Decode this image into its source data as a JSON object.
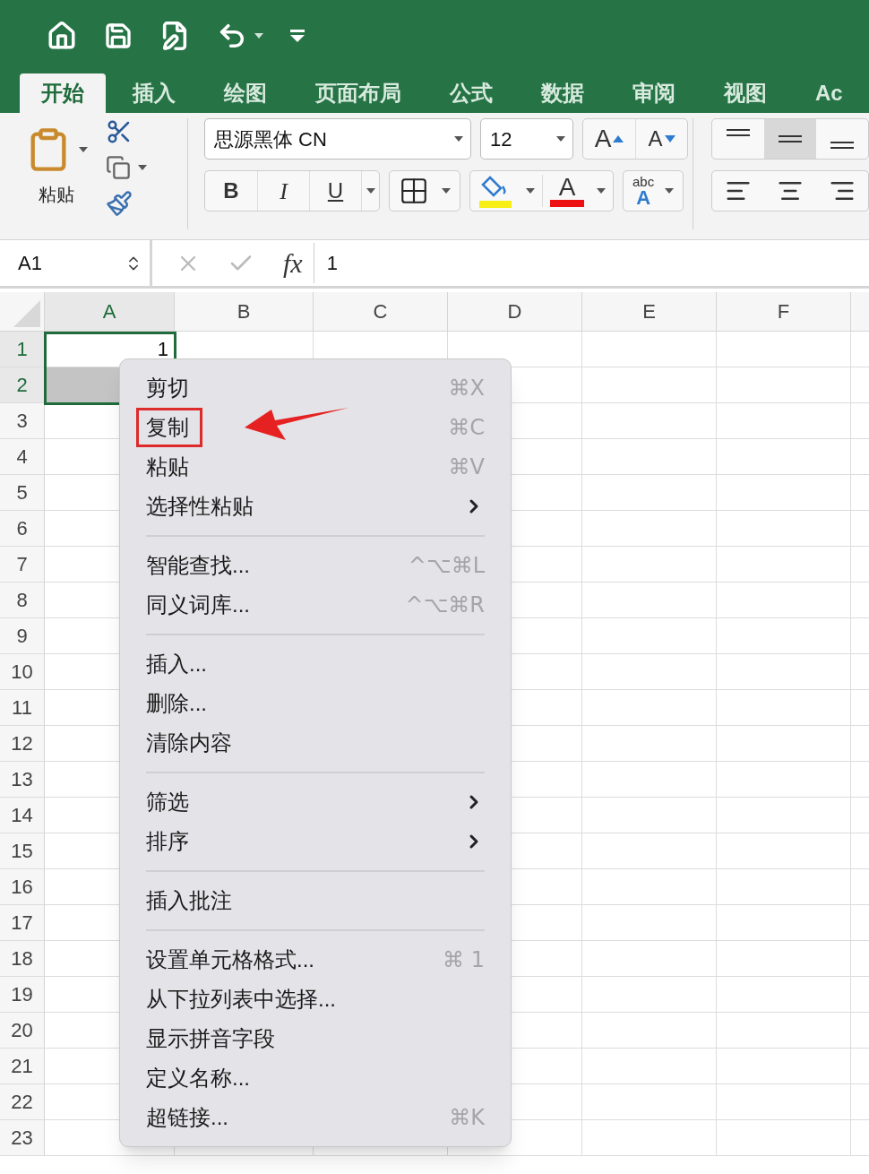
{
  "ribbon_tabs": [
    {
      "label": "开始",
      "selected": true
    },
    {
      "label": "插入",
      "selected": false
    },
    {
      "label": "绘图",
      "selected": false
    },
    {
      "label": "页面布局",
      "selected": false
    },
    {
      "label": "公式",
      "selected": false
    },
    {
      "label": "数据",
      "selected": false
    },
    {
      "label": "审阅",
      "selected": false
    },
    {
      "label": "视图",
      "selected": false
    },
    {
      "label": "Ac",
      "selected": false
    }
  ],
  "clipboard": {
    "paste_label": "粘贴"
  },
  "font": {
    "name": "思源黑体 CN",
    "size": "12",
    "grow_label": "A",
    "shrink_label": "A",
    "bold_label": "B",
    "italic_label": "I",
    "underline_label": "U",
    "font_color_label": "A",
    "phonetic_top": "abc",
    "phonetic_bottom": "A"
  },
  "vertical_align": [
    {
      "kind": "top",
      "selected": false
    },
    {
      "kind": "middle",
      "selected": true
    },
    {
      "kind": "bottom",
      "selected": false
    }
  ],
  "formula_bar": {
    "name_box": "A1",
    "fx": "fx",
    "value": "1"
  },
  "columns": [
    {
      "label": "A",
      "selected": true
    },
    {
      "label": "B",
      "selected": false
    },
    {
      "label": "C",
      "selected": false
    },
    {
      "label": "D",
      "selected": false
    },
    {
      "label": "E",
      "selected": false
    },
    {
      "label": "F",
      "selected": false
    }
  ],
  "rows": [
    {
      "label": "1",
      "selected": true,
      "cell_a": "1"
    },
    {
      "label": "2",
      "selected": true
    },
    {
      "label": "3",
      "selected": false
    },
    {
      "label": "4",
      "selected": false
    },
    {
      "label": "5",
      "selected": false
    },
    {
      "label": "6",
      "selected": false
    },
    {
      "label": "7",
      "selected": false
    },
    {
      "label": "8",
      "selected": false
    },
    {
      "label": "9",
      "selected": false
    },
    {
      "label": "10",
      "selected": false
    },
    {
      "label": "11",
      "selected": false
    },
    {
      "label": "12",
      "selected": false
    },
    {
      "label": "13",
      "selected": false
    },
    {
      "label": "14",
      "selected": false
    },
    {
      "label": "15",
      "selected": false
    },
    {
      "label": "16",
      "selected": false
    },
    {
      "label": "17",
      "selected": false
    },
    {
      "label": "18",
      "selected": false
    },
    {
      "label": "19",
      "selected": false
    },
    {
      "label": "20",
      "selected": false
    },
    {
      "label": "21",
      "selected": false
    },
    {
      "label": "22",
      "selected": false
    },
    {
      "label": "23",
      "selected": false
    }
  ],
  "context_menu": [
    [
      {
        "label": "剪切",
        "shortcut": "⌘X",
        "submenu": false,
        "annotated": false
      },
      {
        "label": "复制",
        "shortcut": "⌘C",
        "submenu": false,
        "annotated": true
      },
      {
        "label": "粘贴",
        "shortcut": "⌘V",
        "submenu": false,
        "annotated": false
      },
      {
        "label": "选择性粘贴",
        "submenu": true,
        "annotated": false
      }
    ],
    [
      {
        "label": "智能查找...",
        "shortcut": "^⌥⌘L",
        "submenu": false,
        "annotated": false
      },
      {
        "label": "同义词库...",
        "shortcut": "^⌥⌘R",
        "submenu": false,
        "annotated": false
      }
    ],
    [
      {
        "label": "插入...",
        "submenu": false,
        "annotated": false
      },
      {
        "label": "删除...",
        "submenu": false,
        "annotated": false
      },
      {
        "label": "清除内容",
        "submenu": false,
        "annotated": false
      }
    ],
    [
      {
        "label": "筛选",
        "submenu": true,
        "annotated": false
      },
      {
        "label": "排序",
        "submenu": true,
        "annotated": false
      }
    ],
    [
      {
        "label": "插入批注",
        "submenu": false,
        "annotated": false
      }
    ],
    [
      {
        "label": "设置单元格格式...",
        "shortcut": "⌘ 1",
        "submenu": false,
        "annotated": false
      },
      {
        "label": "从下拉列表中选择...",
        "submenu": false,
        "annotated": false
      },
      {
        "label": "显示拼音字段",
        "submenu": false,
        "annotated": false
      },
      {
        "label": "定义名称...",
        "submenu": false,
        "annotated": false
      },
      {
        "label": "超链接...",
        "shortcut": "⌘K",
        "submenu": false,
        "annotated": false
      }
    ]
  ]
}
